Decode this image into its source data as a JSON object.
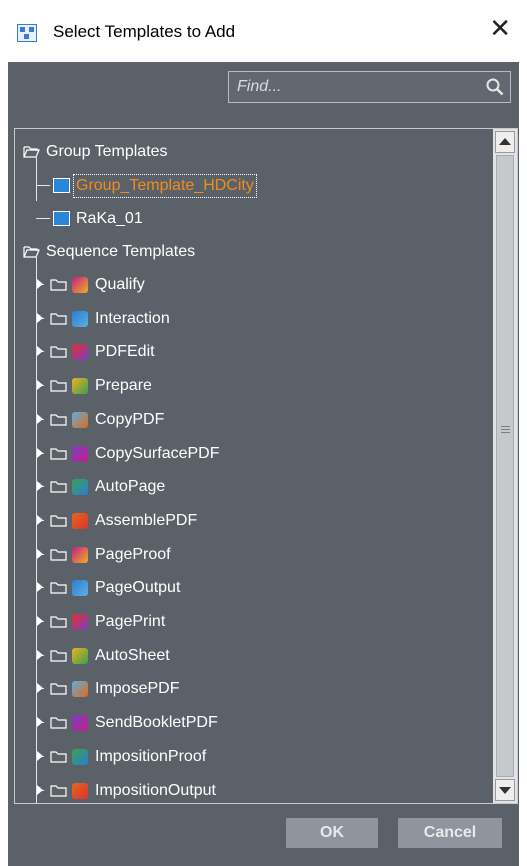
{
  "window": {
    "title": "Select Templates to Add"
  },
  "search": {
    "placeholder": "Find..."
  },
  "tree": {
    "groups": [
      {
        "label": "Group Templates",
        "items": [
          {
            "label": "Group_Template_HDCity",
            "selected": true,
            "color": "#f08c1c"
          },
          {
            "label": "RaKa_01",
            "selected": false
          }
        ]
      },
      {
        "label": "Sequence Templates",
        "items": [
          {
            "label": "Qualify",
            "icon": "qualify-icon"
          },
          {
            "label": "Interaction",
            "icon": "interaction-icon"
          },
          {
            "label": "PDFEdit",
            "icon": "pdfedit-icon"
          },
          {
            "label": "Prepare",
            "icon": "prepare-icon"
          },
          {
            "label": "CopyPDF",
            "icon": "copypdf-icon"
          },
          {
            "label": "CopySurfacePDF",
            "icon": "copysurfacepdf-icon"
          },
          {
            "label": "AutoPage",
            "icon": "autopage-icon"
          },
          {
            "label": "AssemblePDF",
            "icon": "assemblepdf-icon"
          },
          {
            "label": "PageProof",
            "icon": "pageproof-icon"
          },
          {
            "label": "PageOutput",
            "icon": "pageoutput-icon"
          },
          {
            "label": "PagePrint",
            "icon": "pageprint-icon"
          },
          {
            "label": "AutoSheet",
            "icon": "autosheet-icon"
          },
          {
            "label": "ImposePDF",
            "icon": "imposepdf-icon"
          },
          {
            "label": "SendBookletPDF",
            "icon": "sendbookletpdf-icon"
          },
          {
            "label": "ImpositionProof",
            "icon": "impositionproof-icon"
          },
          {
            "label": "ImpositionOutput",
            "icon": "impositionoutput-icon"
          }
        ]
      }
    ]
  },
  "buttons": {
    "ok": "OK",
    "cancel": "Cancel"
  },
  "colors": {
    "panel": "#5b6168",
    "selected_text": "#f08c1c",
    "button": "#8e959c"
  }
}
